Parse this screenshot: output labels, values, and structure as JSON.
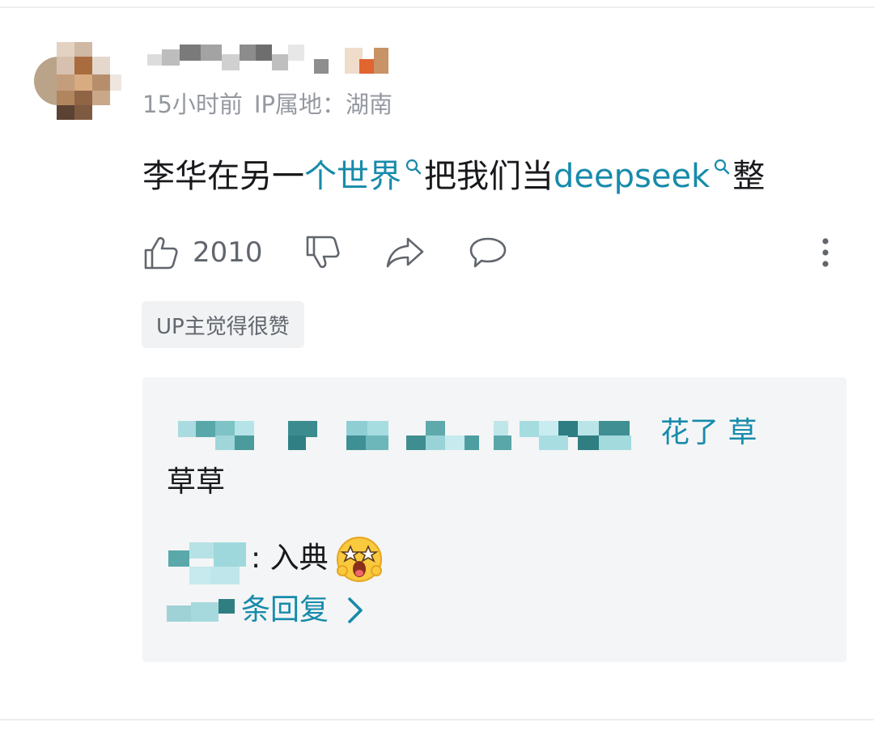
{
  "comment": {
    "meta": {
      "time": "15小时前",
      "ip_location": "IP属地：湖南"
    },
    "text": {
      "part1": "李华在另一",
      "link1": "个世界",
      "part2": "把我们当",
      "link2": "deepseek",
      "part3": "整"
    },
    "link_icon": "search-icon",
    "actions": {
      "like_count": "2010",
      "icons": [
        "thumb-up-icon",
        "thumb-down-icon",
        "share-icon",
        "comment-icon",
        "more-vertical-icon"
      ]
    },
    "badge": "UP主觉得很赞"
  },
  "replies": {
    "reply1": {
      "text_tail": "花了 草",
      "continuation": "草草"
    },
    "reply2": {
      "text": ": 入典",
      "emoji": "star-eyes-emoji"
    },
    "more": {
      "label": "条回复",
      "icon": "chevron-right-icon"
    }
  },
  "colors": {
    "link": "#178bab",
    "meta": "#9499a0",
    "reply_bg": "#f4f5f6"
  }
}
